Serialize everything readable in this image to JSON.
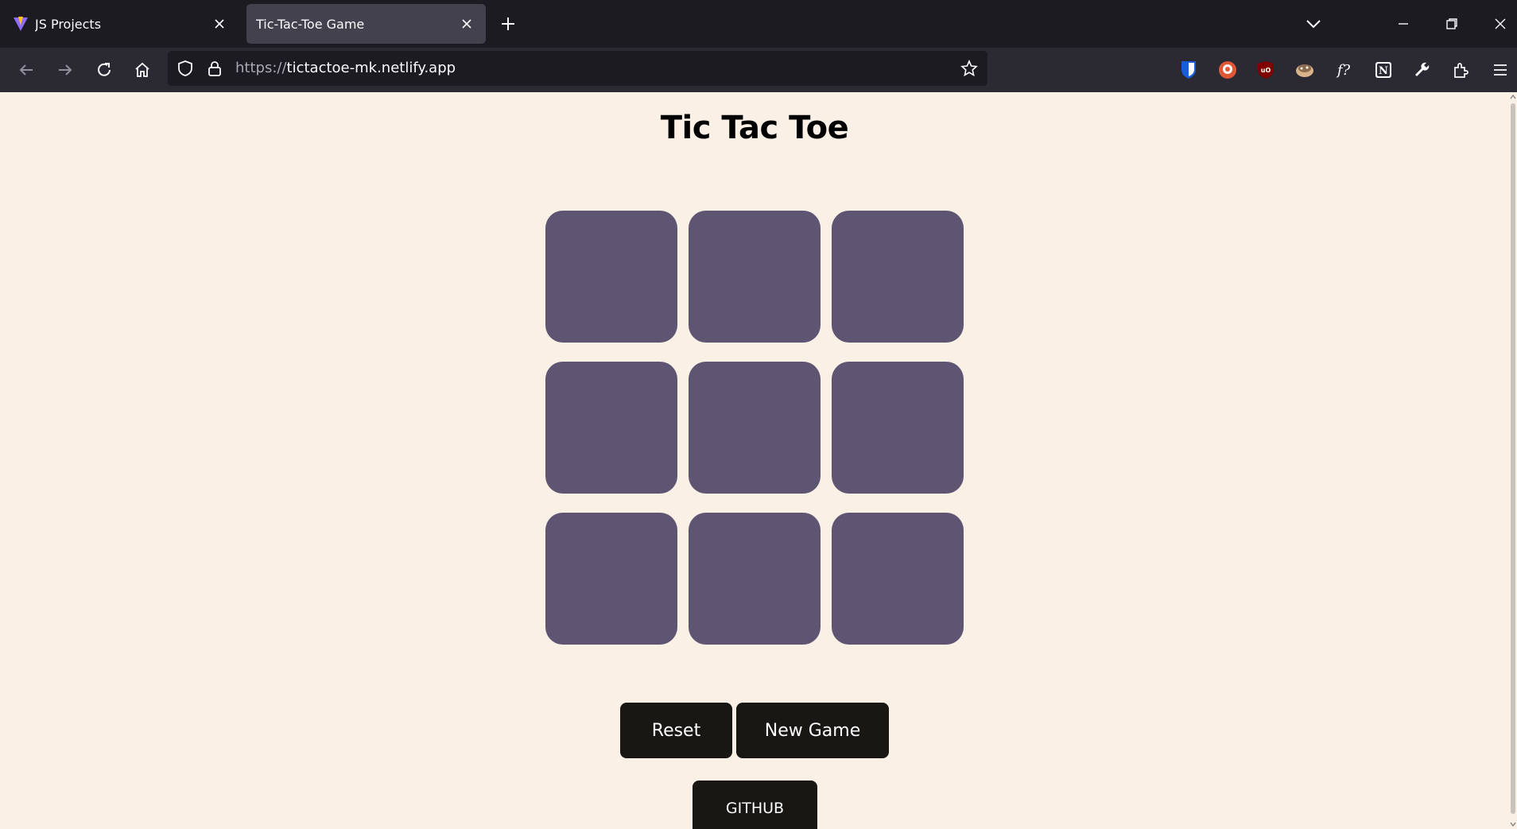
{
  "browser": {
    "tabs": [
      {
        "title": "JS Projects",
        "active": false
      },
      {
        "title": "Tic-Tac-Toe Game",
        "active": true
      }
    ],
    "url": {
      "scheme": "https://",
      "host": "tictactoe-mk.netlify.app"
    },
    "extensions": [
      "bitwarden-icon",
      "duckduckgo-icon",
      "ublock-origin-icon",
      "cookie-icon",
      "font-finder-icon",
      "notion-icon",
      "wrench-icon",
      "extensions-icon",
      "menu-icon"
    ]
  },
  "game": {
    "title": "Tic Tac Toe",
    "board": [
      "",
      "",
      "",
      "",
      "",
      "",
      "",
      "",
      ""
    ],
    "reset_label": "Reset",
    "new_game_label": "New Game",
    "github_label": "GITHUB"
  },
  "colors": {
    "page_bg": "#faf0e6",
    "cell": "#5e5572",
    "button": "#181714"
  }
}
